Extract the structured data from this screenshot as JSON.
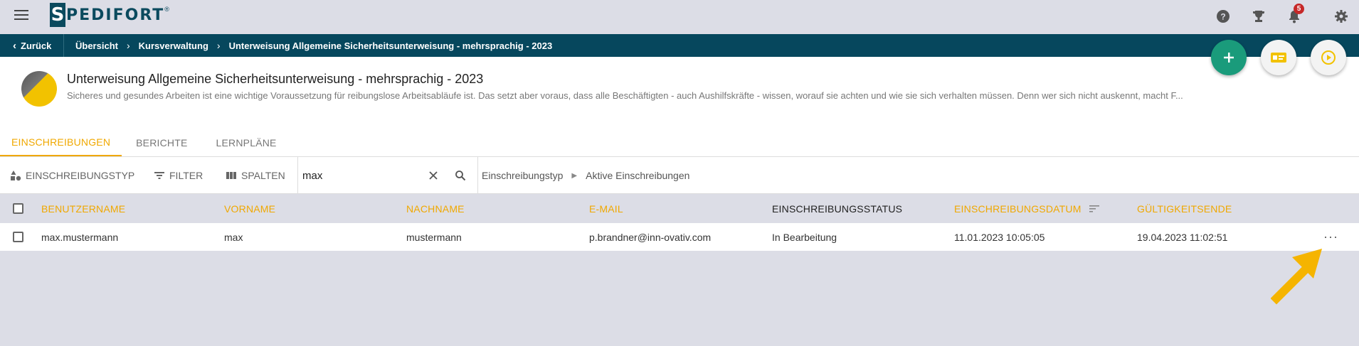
{
  "app": {
    "logo_letter": "S",
    "logo_text": "PEDIFORT",
    "logo_reg": "®",
    "notification_count": "5"
  },
  "breadcrumb": {
    "back_label": "Zurück",
    "items": [
      "Übersicht",
      "Kursverwaltung",
      "Unterweisung Allgemeine Sicherheitsunterweisung - mehrsprachig - 2023"
    ]
  },
  "course": {
    "title": "Unterweisung Allgemeine Sicherheitsunterweisung - mehrsprachig - 2023",
    "description": "Sicheres und gesundes Arbeiten ist eine wichtige Voraussetzung für reibungslose Arbeitsabläufe ist. Das setzt aber voraus, dass alle Beschäftigten - auch Aushilfskräfte - wissen, worauf sie achten und wie sie sich verhalten müssen. Denn wer sich nicht auskennt, macht F..."
  },
  "tabs": [
    {
      "label": "EINSCHREIBUNGEN",
      "active": true
    },
    {
      "label": "BERICHTE",
      "active": false
    },
    {
      "label": "LERNPLÄNE",
      "active": false
    }
  ],
  "toolbar": {
    "type_label": "EINSCHREIBUNGSTYP",
    "filter_label": "FILTER",
    "columns_label": "SPALTEN",
    "search_value": "max",
    "chip_label": "Einschreibungstyp",
    "chip_value": "Aktive Einschreibungen"
  },
  "table": {
    "columns": [
      "BENUTZERNAME",
      "VORNAME",
      "NACHNAME",
      "E-MAIL",
      "EINSCHREIBUNGSSTATUS",
      "EINSCHREIBUNGSDATUM",
      "GÜLTIGKEITSENDE"
    ],
    "rows": [
      {
        "username": "max.mustermann",
        "firstname": "max",
        "lastname": "mustermann",
        "email": "p.brandner@inn-ovativ.com",
        "status": "In Bearbeitung",
        "enrolled": "11.01.2023 10:05:05",
        "valid_until": "19.04.2023 11:02:51"
      }
    ],
    "more_label": "···"
  },
  "colors": {
    "brand": "#06475d",
    "accent": "#f0a800",
    "fab_green": "#1a9b7b",
    "fab_yellow": "#f2c200",
    "badge": "#c62828"
  }
}
